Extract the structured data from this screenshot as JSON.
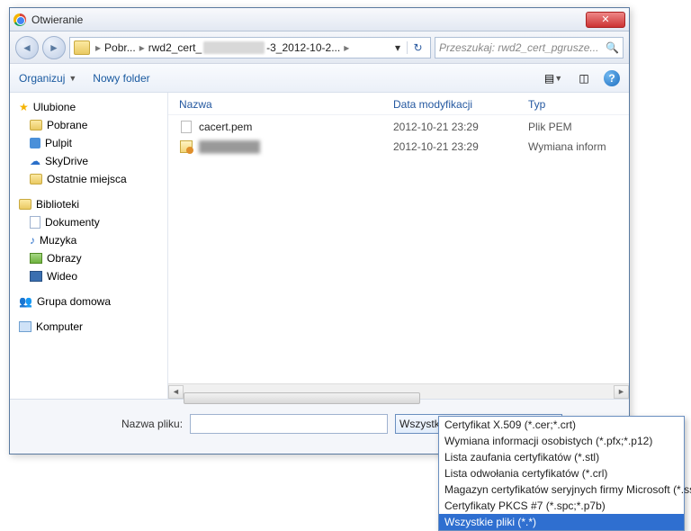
{
  "window": {
    "title": "Otwieranie"
  },
  "breadcrumb": {
    "root": "Pobr...",
    "folder_prefix": "rwd2_cert_",
    "folder_blur": "████████",
    "folder_suffix": "-3_2012-10-2..."
  },
  "search": {
    "placeholder": "Przeszukaj: rwd2_cert_pgrusze..."
  },
  "toolbar": {
    "organize": "Organizuj",
    "newfolder": "Nowy folder"
  },
  "sidebar": {
    "favorites": "Ulubione",
    "fav_items": [
      "Pobrane",
      "Pulpit",
      "SkyDrive",
      "Ostatnie miejsca"
    ],
    "libraries": "Biblioteki",
    "lib_items": [
      "Dokumenty",
      "Muzyka",
      "Obrazy",
      "Wideo"
    ],
    "homegroup": "Grupa domowa",
    "computer": "Komputer"
  },
  "columns": {
    "name": "Nazwa",
    "date": "Data modyfikacji",
    "type": "Typ"
  },
  "files": [
    {
      "name": "cacert.pem",
      "date": "2012-10-21 23:29",
      "type": "Plik PEM",
      "icon": "page"
    },
    {
      "name": "████████",
      "date": "2012-10-21 23:29",
      "type": "Wymiana inform",
      "icon": "cert",
      "blur": true
    }
  ],
  "bottom": {
    "label": "Nazwa pliku:",
    "filetype_selected": "Wszystkie pliki (*.*)"
  },
  "dropdown": [
    "Certyfikat X.509 (*.cer;*.crt)",
    "Wymiana informacji osobistych (*.pfx;*.p12)",
    "Lista zaufania certyfikatów (*.stl)",
    "Lista odwołania certyfikatów (*.crl)",
    "Magazyn certyfikatów seryjnych firmy Microsoft (*.sst)",
    "Certyfikaty PKCS #7 (*.spc;*.p7b)",
    "Wszystkie pliki (*.*)"
  ],
  "dropdown_selected_index": 6
}
